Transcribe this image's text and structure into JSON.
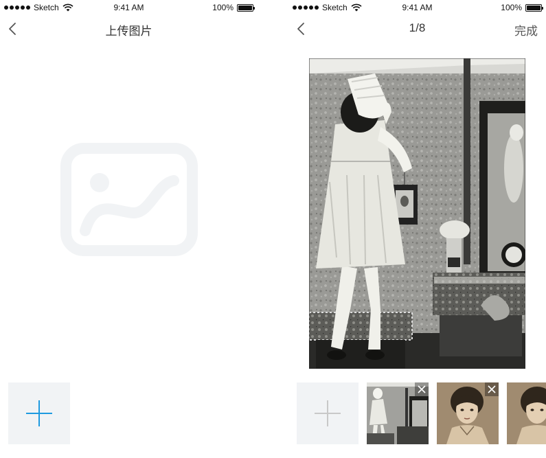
{
  "status_bar": {
    "carrier": "Sketch",
    "time": "9:41 AM",
    "battery_text": "100%",
    "battery_level": 1.0
  },
  "upload_screen": {
    "title": "上传图片",
    "back_icon": "chevron-left-icon",
    "placeholder_icon": "image-placeholder-icon",
    "add_icon": "plus-icon",
    "add_icon_color": "#1e9ae0"
  },
  "preview_screen": {
    "page_indicator": "1/8",
    "done_label": "完成",
    "back_icon": "chevron-left-icon",
    "add_icon": "plus-icon",
    "add_icon_color": "#c8c8c8",
    "remove_icon": "close-icon",
    "thumbnails": [
      {
        "name": "girl-standing-photo",
        "removable": true
      },
      {
        "name": "sepia-portrait-photo",
        "removable": true
      },
      {
        "name": "sepia-portrait-photo-2",
        "removable": false
      }
    ]
  },
  "colors": {
    "placeholder_gray": "#f1f3f5",
    "add_tile_bg": "#f1f3f5"
  }
}
